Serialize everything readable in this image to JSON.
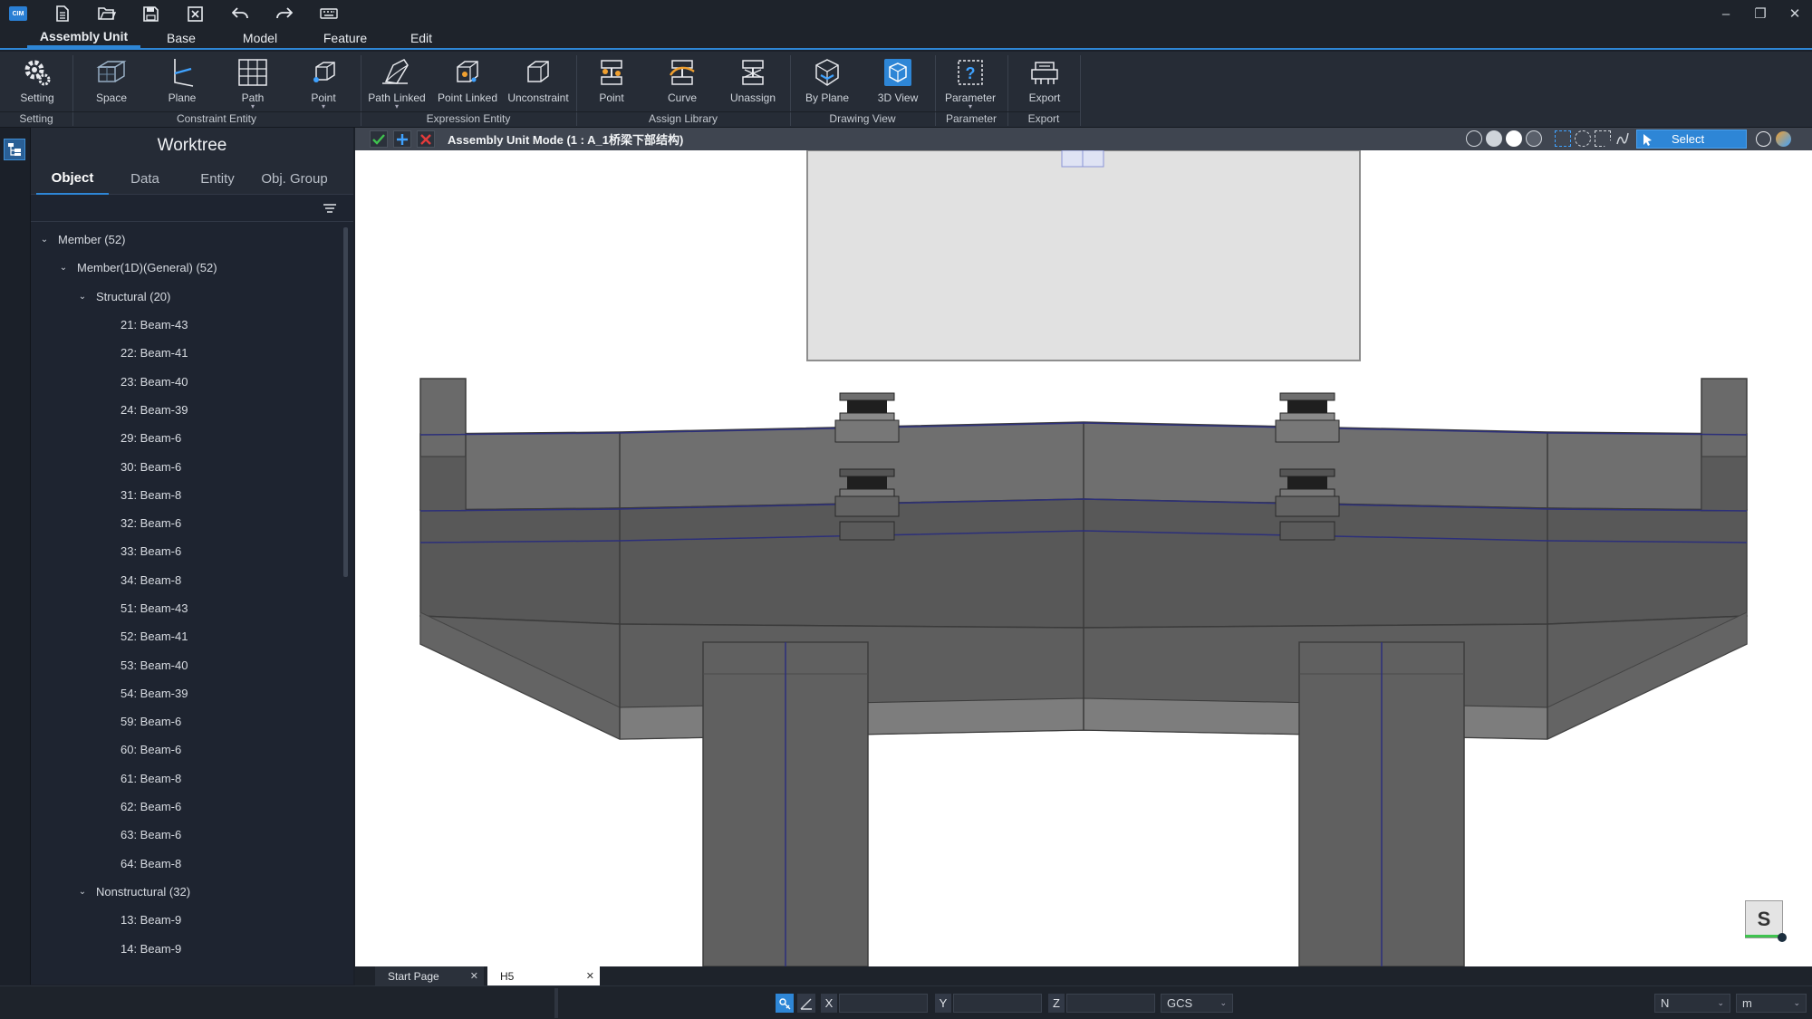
{
  "quick_access": [
    "new-file-icon",
    "open-folder-icon",
    "save-icon",
    "close-file-icon",
    "undo-icon",
    "redo-icon",
    "keyboard-icon"
  ],
  "app_logo": "CIM",
  "menu_tabs": [
    {
      "label": "Assembly Unit",
      "active": true
    },
    {
      "label": "Base",
      "active": false
    },
    {
      "label": "Model",
      "active": false
    },
    {
      "label": "Feature",
      "active": false
    },
    {
      "label": "Edit",
      "active": false
    }
  ],
  "ribbon": {
    "buttons": [
      {
        "label": "Setting",
        "icon": "gear-icon"
      },
      {
        "label": "Space",
        "icon": "space-icon"
      },
      {
        "label": "Plane",
        "icon": "plane-icon"
      },
      {
        "label": "Path",
        "icon": "path-icon",
        "dropdown": true
      },
      {
        "label": "Point",
        "icon": "point-icon",
        "dropdown": true
      },
      {
        "label": "Path Linked",
        "icon": "path-linked-icon",
        "dropdown": true
      },
      {
        "label": "Point Linked",
        "icon": "point-linked-icon"
      },
      {
        "label": "Unconstraint",
        "icon": "unconstraint-icon"
      },
      {
        "label": "Point",
        "icon": "assign-point-icon"
      },
      {
        "label": "Curve",
        "icon": "curve-icon"
      },
      {
        "label": "Unassign",
        "icon": "unassign-icon"
      },
      {
        "label": "By Plane",
        "icon": "by-plane-icon"
      },
      {
        "label": "3D View",
        "icon": "3d-view-icon"
      },
      {
        "label": "Parameter",
        "icon": "parameter-icon",
        "dropdown": true
      },
      {
        "label": "Export",
        "icon": "export-icon"
      }
    ],
    "groups": [
      "Setting",
      "Constraint Entity",
      "Expression Entity",
      "Assign Library",
      "Drawing View",
      "Parameter",
      "Export"
    ]
  },
  "worktree": {
    "title": "Worktree",
    "tabs": [
      "Object",
      "Data",
      "Entity",
      "Obj. Group"
    ],
    "active_tab": "Object",
    "items": [
      {
        "label": "Member (52)",
        "level": 0,
        "expandable": true
      },
      {
        "label": "Member(1D)(General) (52)",
        "level": 1,
        "expandable": true
      },
      {
        "label": "Structural (20)",
        "level": 2,
        "expandable": true
      },
      {
        "label": "21: Beam-43",
        "level": 3
      },
      {
        "label": "22: Beam-41",
        "level": 3
      },
      {
        "label": "23: Beam-40",
        "level": 3
      },
      {
        "label": "24: Beam-39",
        "level": 3
      },
      {
        "label": "29: Beam-6",
        "level": 3
      },
      {
        "label": "30: Beam-6",
        "level": 3
      },
      {
        "label": "31: Beam-8",
        "level": 3
      },
      {
        "label": "32: Beam-6",
        "level": 3
      },
      {
        "label": "33: Beam-6",
        "level": 3
      },
      {
        "label": "34: Beam-8",
        "level": 3
      },
      {
        "label": "51: Beam-43",
        "level": 3
      },
      {
        "label": "52: Beam-41",
        "level": 3
      },
      {
        "label": "53: Beam-40",
        "level": 3
      },
      {
        "label": "54: Beam-39",
        "level": 3
      },
      {
        "label": "59: Beam-6",
        "level": 3
      },
      {
        "label": "60: Beam-6",
        "level": 3
      },
      {
        "label": "61: Beam-8",
        "level": 3
      },
      {
        "label": "62: Beam-6",
        "level": 3
      },
      {
        "label": "63: Beam-6",
        "level": 3
      },
      {
        "label": "64: Beam-8",
        "level": 3
      },
      {
        "label": "Nonstructural (32)",
        "level": 2,
        "expandable": true
      },
      {
        "label": "13: Beam-9",
        "level": 3
      },
      {
        "label": "14: Beam-9",
        "level": 3
      }
    ]
  },
  "viewport": {
    "mode_title": "Assembly Unit Mode (1 : A_1桥梁下部结构)",
    "select_label": "Select",
    "view_cube_label": "S"
  },
  "doc_tabs": [
    {
      "label": "Start Page",
      "active": false
    },
    {
      "label": "H5",
      "active": true
    }
  ],
  "statusbar": {
    "x_label": "X",
    "y_label": "Y",
    "z_label": "Z",
    "x_value": "",
    "y_value": "",
    "z_value": "",
    "coord_system": "GCS",
    "force_unit": "N",
    "length_unit": "m"
  },
  "colors": {
    "accent": "#2e86d6",
    "confirm": "#3fc34f",
    "cancel": "#e23b3b"
  }
}
